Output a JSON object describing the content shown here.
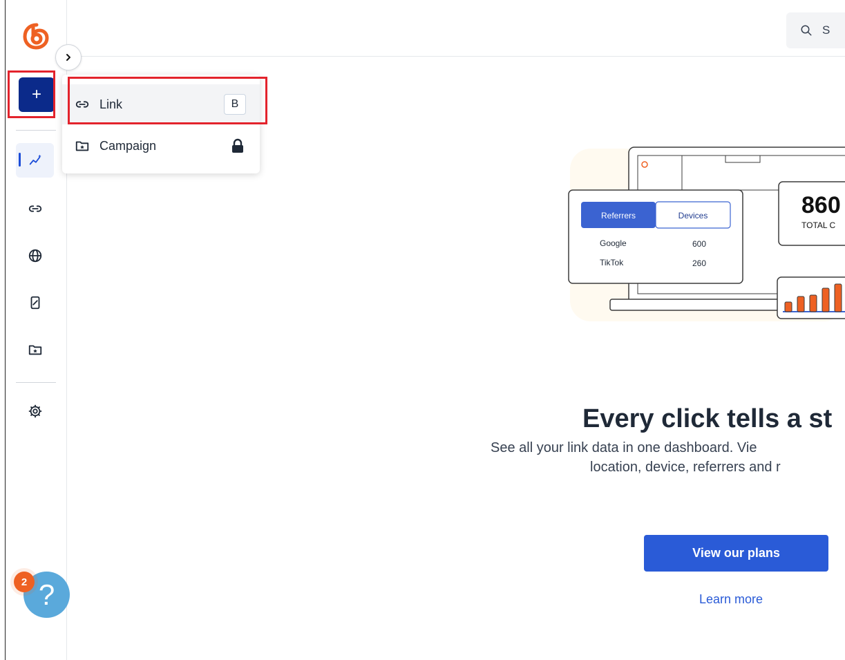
{
  "colors": {
    "brand": "#ee6123",
    "primary": "#2a5bd7",
    "navy": "#0b2a8a",
    "highlight": "#e3232c"
  },
  "sidebar": {
    "create_label": "+",
    "items": [
      {
        "name": "analytics",
        "icon": "sparkline-icon",
        "active": true
      },
      {
        "name": "links",
        "icon": "link-icon"
      },
      {
        "name": "domains",
        "icon": "globe-icon"
      },
      {
        "name": "qr-codes",
        "icon": "mobile-chart-icon"
      },
      {
        "name": "campaigns",
        "icon": "folder-star-icon"
      },
      {
        "name": "settings",
        "icon": "gear-icon"
      }
    ]
  },
  "topbar": {
    "search_placeholder": "S"
  },
  "create_menu": {
    "items": [
      {
        "label": "Link",
        "shortcut": "B",
        "icon": "link-icon"
      },
      {
        "label": "Campaign",
        "icon": "folder-star-icon",
        "locked": true
      }
    ]
  },
  "illustration": {
    "tabs": [
      "Referrers",
      "Devices"
    ],
    "rows": [
      {
        "name": "Google",
        "value": "600"
      },
      {
        "name": "TikTok",
        "value": "260"
      }
    ],
    "total_value": "860",
    "total_label": "TOTAL C"
  },
  "hero": {
    "title": "Every click tells a st",
    "subtitle_line1": "See all your link data in one dashboard. Vie",
    "subtitle_line2": "location, device, referrers and r",
    "cta_label": "View our plans",
    "learn_more": "Learn more"
  },
  "help": {
    "badge": "2",
    "symbol": "?"
  }
}
